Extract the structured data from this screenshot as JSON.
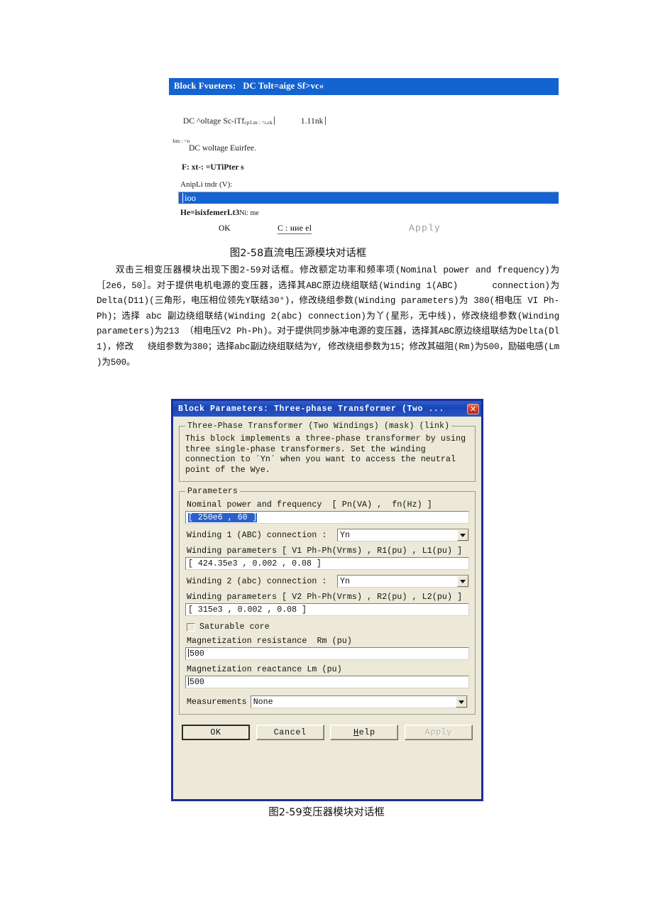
{
  "figure1": {
    "name": "dc-voltage-source-dialog-scan",
    "titlebar": "Block Fvueters:   DC Tolt=aige Sf>vc«",
    "source_line_main": "DC ^oltage Sc-iTf",
    "source_line_tiny1": "cp1.m : =ι.εk",
    "source_line_tiny2": "1.11nk",
    "description_tiny": "Iιm : =ιι",
    "description_main": "DC woltage Euirfee.",
    "parameters_head": "F: xt-: =UTiPter s",
    "amplitude_label": "AnipLi tndr (V):",
    "amplitude_value": "ioo",
    "footer_bold": "He=isixfemerLt3",
    "footer_thin": "Ni: me",
    "buttons": {
      "ok": "OK",
      "cancel": "C : ние el",
      "apply": "Apply"
    },
    "caption": "图2-58直流电压源模块对话框"
  },
  "paragraph": {
    "text": "　　双击三相变压器模块出现下图2-59对话框。修改额定功率和频率项(Nominal power and frequency)为［2e6，50］。对于提供电机电源的变压器，选择其ABC原边绕组联结(Winding 1(ABC)　　　 connection)为Delta(D11)(三角形，电压相位领先Y联结30°)，修改绕组参数(Winding parameters)为 380(相电压 VI Ph-Ph)；选择 abc 副边绕组联结(Winding 2(abc) connection)为丫(星形，无中线)，修改绕组参数(Winding parameters)为213 （相电压V2 Ph-Ph)。对于提供同步脉冲电源的变压器，选择其ABC原边绕组联结为Delta(Dl 1)，修改　 绕组参数为380；选择abc副边绕组联结为Y, 修改绕组参数为15；修改其磁阻(Rm)为500，励磁电感(Lm )为500。"
  },
  "figure2": {
    "name": "three-phase-transformer-dialog",
    "titlebar": "Block Parameters: Three-phase Transformer (Two ...",
    "close_glyph": "✕",
    "description_group": {
      "legend": "Three-Phase Transformer (Two Windings) (mask) (link)",
      "text": "This block implements a three-phase transformer by using\nthree single-phase transformers. Set the winding\nconnection to ´Yn´  when you want to access the neutral\npoint of the Wye."
    },
    "parameters_group": {
      "legend": "Parameters",
      "nominal_label": "Nominal power and frequency  [ Pn(VA) ,  fn(Hz) ]",
      "nominal_value": "[ 250e6 , 60 ]",
      "winding1_label": "Winding 1 (ABC) connection :",
      "winding1_value": "Yn",
      "winding1_params_label": "Winding parameters [ V1 Ph-Ph(Vrms) , R1(pu) , L1(pu) ]",
      "winding1_params_value": "[ 424.35e3 , 0.002 , 0.08 ]",
      "winding2_label": "Winding 2 (abc) connection :",
      "winding2_value": "Yn",
      "winding2_params_label": "Winding parameters [ V2 Ph-Ph(Vrms) , R2(pu) , L2(pu) ]",
      "winding2_params_value": "[ 315e3 , 0.002 , 0.08 ]",
      "saturable_core_label": "Saturable core",
      "saturable_core_checked": false,
      "rm_label": "Magnetization resistance  Rm (pu)",
      "rm_value": "500",
      "lm_label": "Magnetization reactance Lm (pu)",
      "lm_value": "500",
      "measurements_label": "Measurements",
      "measurements_value": "None"
    },
    "buttons": {
      "ok": "OK",
      "cancel": "Cancel",
      "help_prefix": "H",
      "help_rest": "elp",
      "apply": "Apply"
    },
    "caption": "图2-59变压器模块对话框"
  },
  "colors": {
    "titlebar_blue": "#1463d2",
    "dialog_border_blue": "#1b2f9c",
    "dialog_face": "#ece9d8",
    "selection_blue": "#2b5fc9",
    "close_red": "#d03a23"
  }
}
